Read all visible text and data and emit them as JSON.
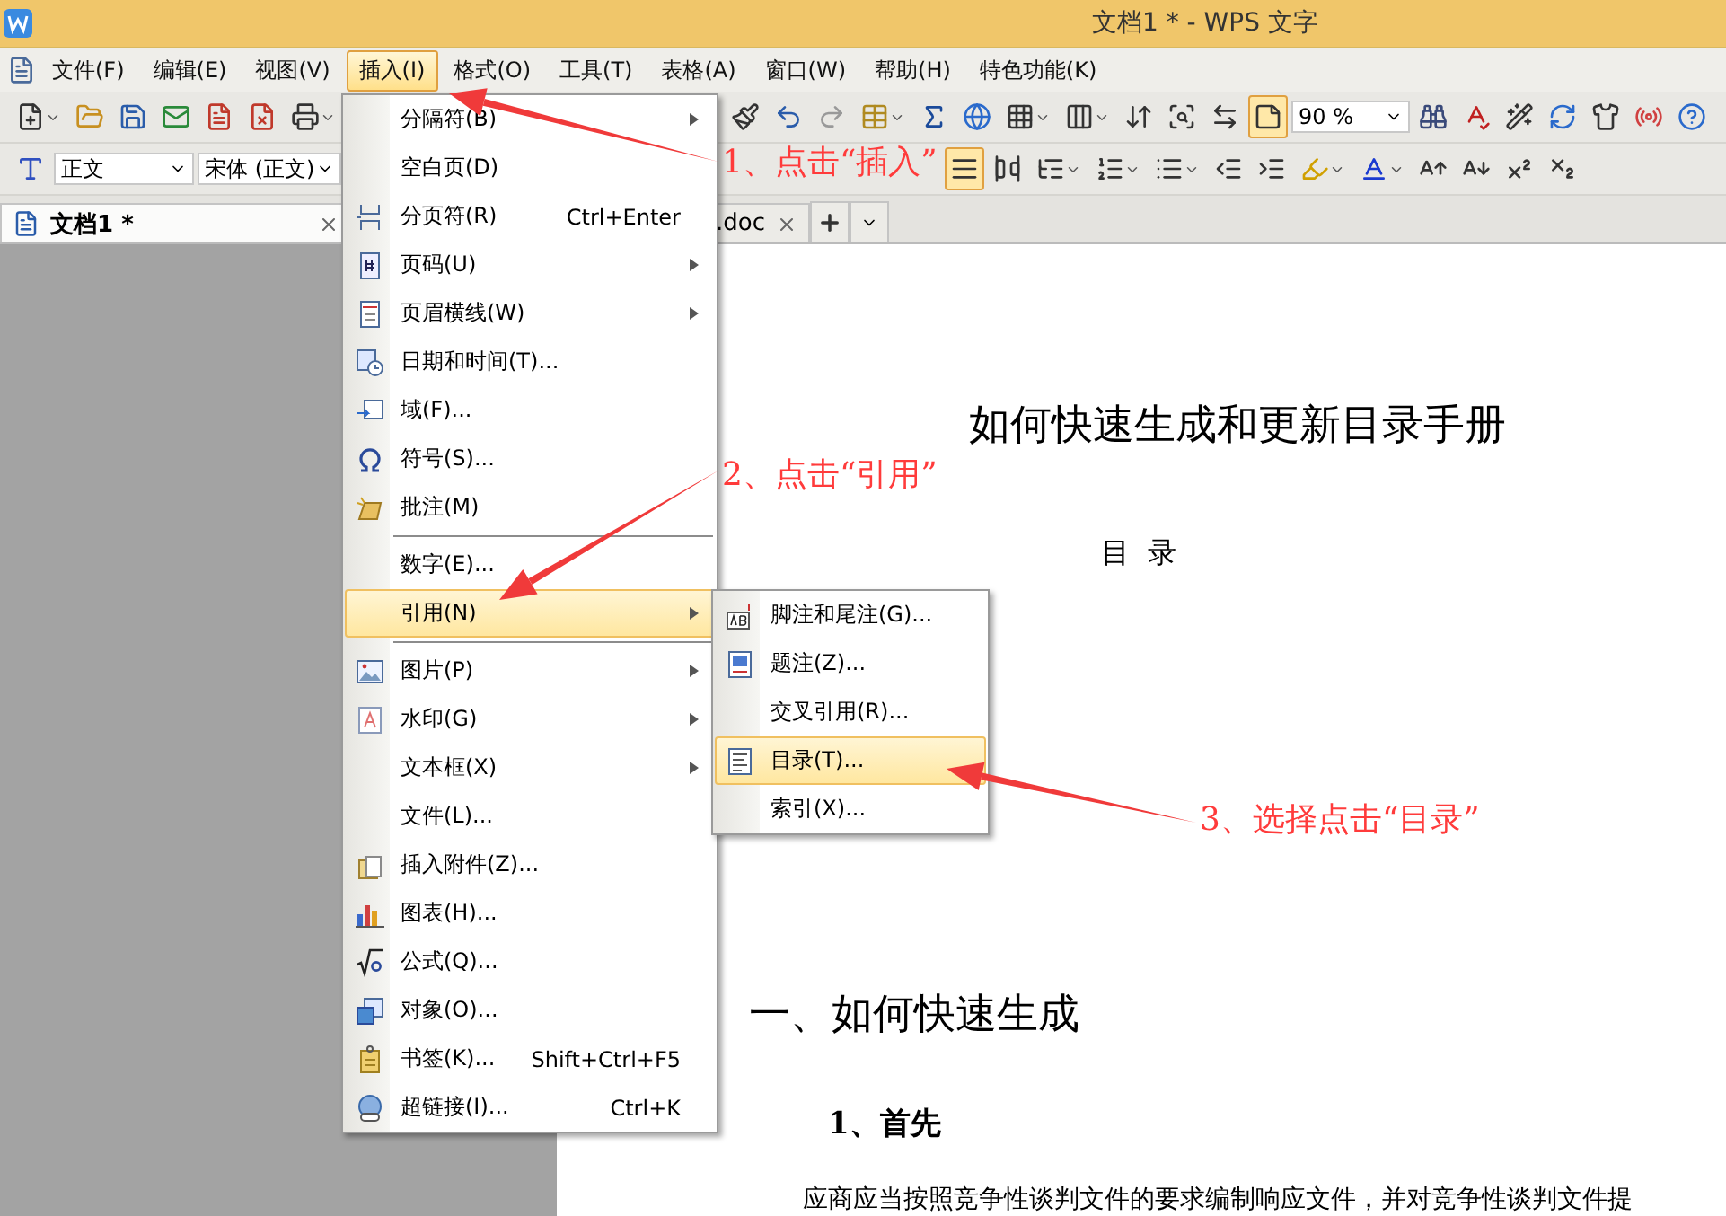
{
  "window": {
    "title": "文档1 * - WPS 文字"
  },
  "menubar": [
    {
      "label": "文件(F)",
      "selected": false
    },
    {
      "label": "编辑(E)",
      "selected": false
    },
    {
      "label": "视图(V)",
      "selected": false
    },
    {
      "label": "插入(I)",
      "selected": true
    },
    {
      "label": "格式(O)",
      "selected": false
    },
    {
      "label": "工具(T)",
      "selected": false
    },
    {
      "label": "表格(A)",
      "selected": false
    },
    {
      "label": "窗口(W)",
      "selected": false
    },
    {
      "label": "帮助(H)",
      "selected": false
    },
    {
      "label": "特色功能(K)",
      "selected": false
    }
  ],
  "toolbar_toggles": [
    {
      "selected": true
    },
    {
      "selected": true
    }
  ],
  "zoom": {
    "value": "90 %"
  },
  "style_box": {
    "value": "正文"
  },
  "font_box": {
    "value": "宋体 (正文)"
  },
  "tabs": [
    {
      "label": "文档1 *",
      "selected": true
    },
    {
      "label": ".doc",
      "selected": false
    }
  ],
  "insert_menu": [
    {
      "kind": "item",
      "label": "分隔符(B)",
      "submenu": true,
      "selected": false
    },
    {
      "kind": "item",
      "label": "空白页(D)",
      "submenu": false,
      "selected": false
    },
    {
      "kind": "item",
      "label": "分页符(R)",
      "shortcut": "Ctrl+Enter",
      "submenu": false,
      "selected": false
    },
    {
      "kind": "item",
      "label": "页码(U)",
      "submenu": true,
      "selected": false
    },
    {
      "kind": "item",
      "label": "页眉横线(W)",
      "submenu": true,
      "selected": false
    },
    {
      "kind": "item",
      "label": "日期和时间(T)...",
      "submenu": false,
      "selected": false
    },
    {
      "kind": "item",
      "label": "域(F)...",
      "submenu": false,
      "selected": false
    },
    {
      "kind": "item",
      "label": "符号(S)...",
      "submenu": false,
      "selected": false
    },
    {
      "kind": "item",
      "label": "批注(M)",
      "submenu": false,
      "selected": false
    },
    {
      "kind": "separator"
    },
    {
      "kind": "item",
      "label": "数字(E)...",
      "submenu": false,
      "selected": false
    },
    {
      "kind": "item",
      "label": "引用(N)",
      "submenu": true,
      "selected": true
    },
    {
      "kind": "separator"
    },
    {
      "kind": "item",
      "label": "图片(P)",
      "submenu": true,
      "selected": false
    },
    {
      "kind": "item",
      "label": "水印(G)",
      "submenu": true,
      "selected": false
    },
    {
      "kind": "item",
      "label": "文本框(X)",
      "submenu": true,
      "selected": false
    },
    {
      "kind": "item",
      "label": "文件(L)...",
      "submenu": false,
      "selected": false
    },
    {
      "kind": "item",
      "label": "插入附件(Z)...",
      "submenu": false,
      "selected": false
    },
    {
      "kind": "item",
      "label": "图表(H)...",
      "submenu": false,
      "selected": false
    },
    {
      "kind": "item",
      "label": "公式(Q)...",
      "submenu": false,
      "selected": false
    },
    {
      "kind": "item",
      "label": "对象(O)...",
      "submenu": false,
      "selected": false
    },
    {
      "kind": "item",
      "label": "书签(K)...",
      "shortcut": "Shift+Ctrl+F5",
      "submenu": false,
      "selected": false
    },
    {
      "kind": "item",
      "label": "超链接(I)...",
      "shortcut": "Ctrl+K",
      "submenu": false,
      "selected": false
    }
  ],
  "reference_submenu": [
    {
      "label": "脚注和尾注(G)...",
      "selected": false
    },
    {
      "label": "题注(Z)...",
      "selected": false
    },
    {
      "label": "交叉引用(R)...",
      "selected": false
    },
    {
      "label": "目录(T)...",
      "selected": true
    },
    {
      "label": "索引(X)...",
      "selected": false
    }
  ],
  "document": {
    "title": "如何快速生成和更新目录手册",
    "toc_heading": "目  录",
    "heading_1": "一、如何快速生成",
    "heading_2": "1、首先",
    "paragraph": "应商应当按照竞争性谈判文件的要求编制响应文件，并对竞争性谈判文件提"
  },
  "annotations": [
    {
      "text": "1、点击“插入”"
    },
    {
      "text": "2、点击“引用”"
    },
    {
      "text": "3、选择点击“目录”"
    }
  ]
}
